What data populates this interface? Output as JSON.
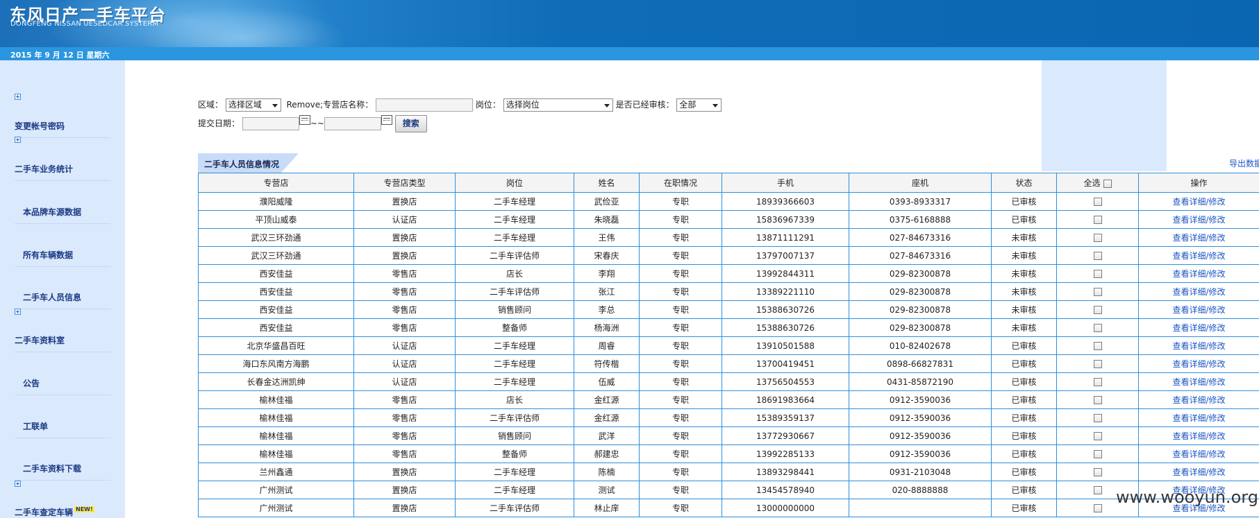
{
  "header": {
    "logo_title": "东风日产二手车平台",
    "logo_subtitle": "DONGFENG NISSAN UESEDCAR SYSTERM",
    "date": "2015 年 9 月 12 日  星期六"
  },
  "sidebar": {
    "items": [
      {
        "label": "变更帐号密码"
      },
      {
        "label": "二手车业务统计"
      },
      {
        "label": "本品牌车源数据"
      },
      {
        "label": "所有车辆数据"
      },
      {
        "label": "二手车人员信息"
      },
      {
        "label": "二手车资料室"
      },
      {
        "label": "公告"
      },
      {
        "label": "工联单"
      },
      {
        "label": "二手车资料下载"
      },
      {
        "label": "二手车查定车辆",
        "badge": "NEW!"
      }
    ]
  },
  "search": {
    "region_label": "区域：",
    "region_value": "选择区域",
    "store_label": "专营店名称：",
    "store_value": "",
    "position_label": "岗位：",
    "position_value": "选择岗位",
    "audited_label": "是否已经审核：",
    "audited_value": "全部",
    "date_label": "提交日期：",
    "date_sep": "~~",
    "date_from": "",
    "date_to": "",
    "search_button": "搜索"
  },
  "section": {
    "title": "二手车人员信息情况",
    "export_link": "导出数据"
  },
  "table": {
    "columns": [
      "专营店",
      "专营店类型",
      "岗位",
      "姓名",
      "在职情况",
      "手机",
      "座机",
      "状态",
      "全选",
      "操作"
    ],
    "op_label": "查看详细/修改",
    "rows": [
      [
        "濮阳威隆",
        "置换店",
        "二手车经理",
        "武俭亚",
        "专职",
        "18939366603",
        "0393-8933317",
        "已审核"
      ],
      [
        "平顶山威泰",
        "认证店",
        "二手车经理",
        "朱晓磊",
        "专职",
        "15836967339",
        "0375-6168888",
        "已审核"
      ],
      [
        "武汉三环劲通",
        "置换店",
        "二手车经理",
        "王伟",
        "专职",
        "13871111291",
        "027-84673316",
        "未审核"
      ],
      [
        "武汉三环劲通",
        "置换店",
        "二手车评估师",
        "宋春庆",
        "专职",
        "13797007137",
        "027-84673316",
        "未审核"
      ],
      [
        "西安佳益",
        "零售店",
        "店长",
        "李翔",
        "专职",
        "13992844311",
        "029-82300878",
        "未审核"
      ],
      [
        "西安佳益",
        "零售店",
        "二手车评估师",
        "张江",
        "专职",
        "13389221110",
        "029-82300878",
        "未审核"
      ],
      [
        "西安佳益",
        "零售店",
        "销售顾问",
        "李总",
        "专职",
        "15388630726",
        "029-82300878",
        "未审核"
      ],
      [
        "西安佳益",
        "零售店",
        "整备师",
        "杨海洲",
        "专职",
        "15388630726",
        "029-82300878",
        "未审核"
      ],
      [
        "北京华盛昌百旺",
        "认证店",
        "二手车经理",
        "周睿",
        "专职",
        "13910501588",
        "010-82402678",
        "已审核"
      ],
      [
        "海口东风南方海鹏",
        "认证店",
        "二手车经理",
        "符传楷",
        "专职",
        "13700419451",
        "0898-66827831",
        "已审核"
      ],
      [
        "长春金达洲凯绅",
        "认证店",
        "二手车经理",
        "伍威",
        "专职",
        "13756504553",
        "0431-85872190",
        "已审核"
      ],
      [
        "榆林佳福",
        "零售店",
        "店长",
        "金红源",
        "专职",
        "18691983664",
        "0912-3590036",
        "已审核"
      ],
      [
        "榆林佳福",
        "零售店",
        "二手车评估师",
        "金红源",
        "专职",
        "15389359137",
        "0912-3590036",
        "已审核"
      ],
      [
        "榆林佳福",
        "零售店",
        "销售顾问",
        "武洋",
        "专职",
        "13772930667",
        "0912-3590036",
        "已审核"
      ],
      [
        "榆林佳福",
        "零售店",
        "整备师",
        "郝建忠",
        "专职",
        "13992285133",
        "0912-3590036",
        "已审核"
      ],
      [
        "兰州鑫通",
        "置换店",
        "二手车经理",
        "陈楠",
        "专职",
        "13893298441",
        "0931-2103048",
        "已审核"
      ],
      [
        "广州测试",
        "置换店",
        "二手车经理",
        "测试",
        "专职",
        "13454578940",
        "020-8888888",
        "已审核"
      ],
      [
        "广州测试",
        "置换店",
        "二手车评估师",
        "林止庠",
        "专职",
        "13000000000",
        "",
        "已审核"
      ]
    ]
  },
  "watermark": "www.wooyun.org",
  "colors": {
    "header_blue": "#0b66b1",
    "datebar_blue": "#2a96e0",
    "sidebar_bg": "#dbe9fd",
    "table_border": "#2d8fdc",
    "link_blue": "#1c55c2"
  }
}
